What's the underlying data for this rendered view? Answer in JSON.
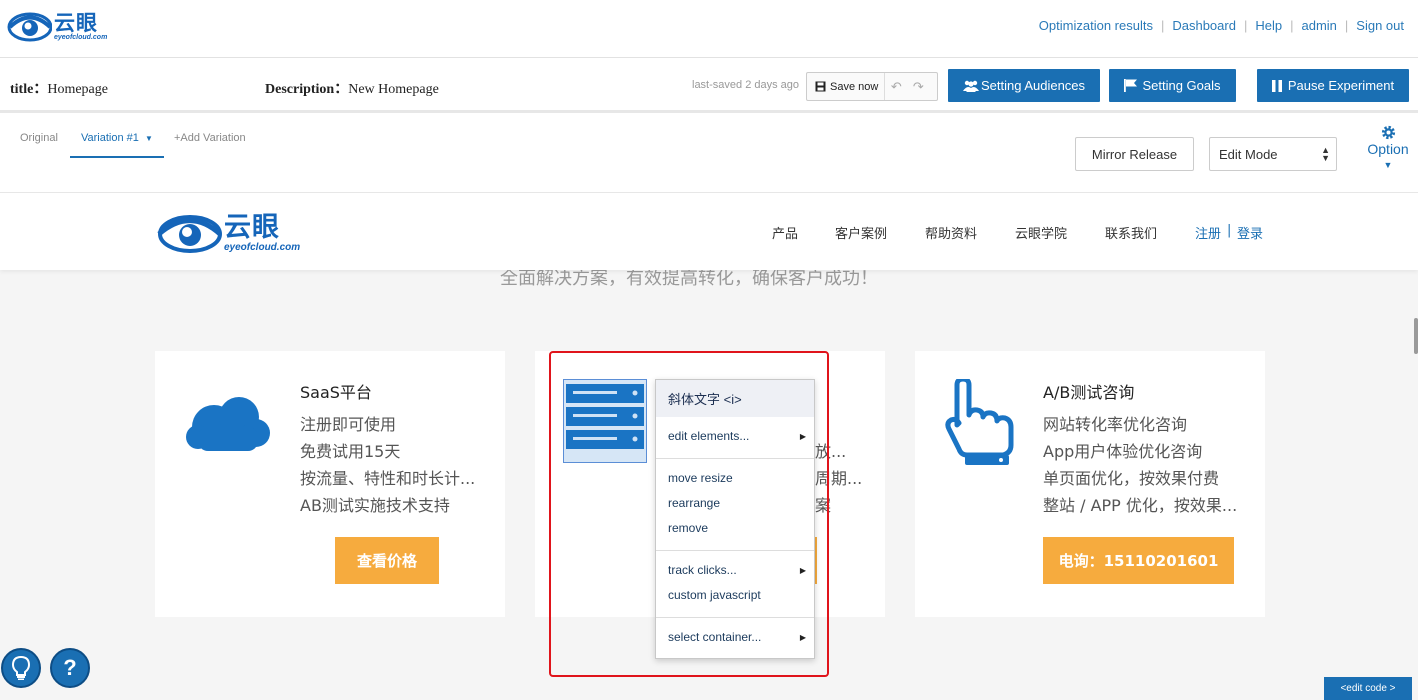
{
  "app": {
    "logo_cn": "云眼",
    "logo_en": "eyeofcloud.com"
  },
  "topnav": {
    "links": [
      "Optimization results",
      "Dashboard",
      "Help",
      "admin",
      "Sign out"
    ]
  },
  "titlebar": {
    "title_label": "title：",
    "title_value": "Homepage",
    "desc_label": "Description：",
    "desc_value": "New Homepage",
    "last_saved": "last-saved 2 days ago",
    "save_label": "Save now",
    "audiences_label": "Setting Audiences",
    "goals_label": "Setting Goals",
    "pause_label": "Pause Experiment"
  },
  "variations": {
    "original": "Original",
    "current": "Variation #1",
    "add": "+Add Variation",
    "mirror_label": "Mirror Release",
    "mode_selected": "Edit Mode",
    "option_label": "Option"
  },
  "site": {
    "nav": [
      "产品",
      "客户案例",
      "帮助资料",
      "云眼学院",
      "联系我们"
    ],
    "register": "注册",
    "login": "登录",
    "slogan": "全面解决方案，有效提高转化，确保客户成功！",
    "cards": [
      {
        "title": "SaaS平台",
        "lines": [
          "注册即可使用",
          "免费试用15天",
          "按流量、特性和时长计...",
          "AB测试实施技术支持"
        ],
        "button": "查看价格"
      },
      {
        "title": "",
        "lines": [
          "放...",
          "周期...",
          "案"
        ],
        "button": ""
      },
      {
        "title": "A/B测试咨询",
        "lines": [
          "网站转化率优化咨询",
          "App用户体验优化咨询",
          "单页面优化，按效果付费",
          "整站 / APP 优化，按效果..."
        ],
        "button": "电询：15110201601"
      }
    ]
  },
  "context_menu": {
    "header": "斜体文字 <i>",
    "edit_elements": "edit elements...",
    "move_resize": "move resize",
    "rearrange": "rearrange",
    "remove": "remove",
    "track_clicks": "track clicks...",
    "custom_js": "custom javascript",
    "select_container": "select container..."
  },
  "footer": {
    "edit_code": "<edit code >",
    "help_glyph": "?"
  },
  "colors": {
    "accent": "#1a6fb3",
    "orange": "#f6ab3e",
    "highlight": "#e0141b"
  }
}
